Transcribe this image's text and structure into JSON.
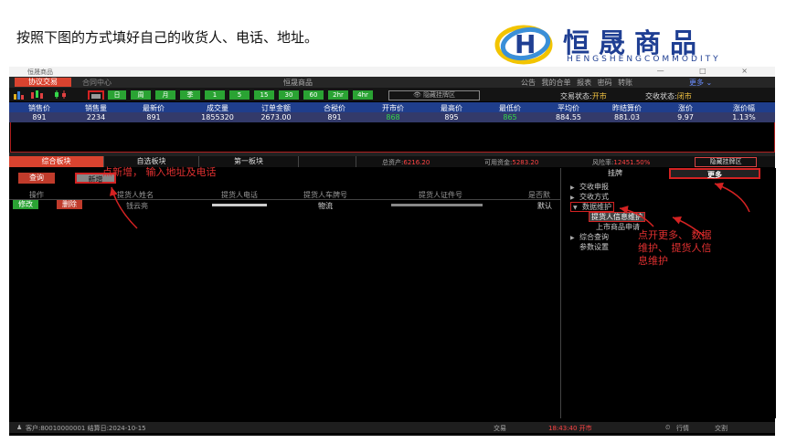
{
  "slide": {
    "instruction": "按照下图的方式填好自己的收货人、电话、地址。"
  },
  "logo": {
    "cn": "恒晟商品",
    "en": "HENGSHENGCOMMODITY"
  },
  "window": {
    "title": "恒晟商品",
    "controls": "— □ ×"
  },
  "menubar": {
    "active": "协议交易",
    "item2": "合同中心",
    "center": "恒晟商品",
    "right": "公告 我的合单 报表 密码 转账",
    "more": "更多 ⌄"
  },
  "toolbar": {
    "periods": [
      "日",
      "周",
      "月",
      "季",
      "1",
      "5",
      "15",
      "30",
      "60",
      "2hr",
      "4hr"
    ],
    "hide": "隐藏挂牌区",
    "trade_status_label": "交易状态:",
    "trade_status": "开市",
    "delivery_status_label": "交收状态:",
    "delivery_status": "闭市"
  },
  "quote": {
    "headers": [
      "销售价",
      "销售量",
      "最新价",
      "成交量",
      "订单金额",
      "合税价",
      "开市价",
      "最高价",
      "最低价",
      "平均价",
      "昨结算价",
      "涨价",
      "涨价幅"
    ],
    "values": [
      "891",
      "2234",
      "891",
      "1855320",
      "2673.00",
      "891",
      "868",
      "895",
      "865",
      "884.55",
      "881.03",
      "9.97",
      "1.13%"
    ]
  },
  "tabs": {
    "t1": "综合板块",
    "t2": "自选板块",
    "t3": "第一板块"
  },
  "account": {
    "assets_label": "总资产:",
    "assets": "6216.20",
    "avail_label": "可用资金:",
    "avail": "5283.20",
    "risk_label": "风险率:",
    "risk": "12451.50%",
    "hide": "隐藏挂牌区"
  },
  "buttons": {
    "query": "查询",
    "add": "新增"
  },
  "table": {
    "headers": [
      "操作",
      "提货人姓名",
      "提货人电话",
      "提货人车牌号",
      "提货人证件号",
      "是否默"
    ],
    "row": {
      "modify": "修改",
      "delete": "删除",
      "name": "钱云亮",
      "vehicle": "物流",
      "default": "默认"
    }
  },
  "right": {
    "tabs": {
      "t1": "挂牌",
      "t2": "更多"
    },
    "tree": [
      "交收申报",
      "交收方式",
      "数据维护",
      "提货人信息维护",
      "上市商品申请",
      "综合查询",
      "参数设置"
    ]
  },
  "notes": {
    "n1": "点新增， 输入地址及电话",
    "n2": "点开更多、 数据维护、 提货人信息维护"
  },
  "status": {
    "client": "客户:80010000001 结算日:2024-10-15",
    "trade": "交易",
    "time": "18:43:40 开市",
    "market": "行情",
    "deliver": "交割"
  }
}
